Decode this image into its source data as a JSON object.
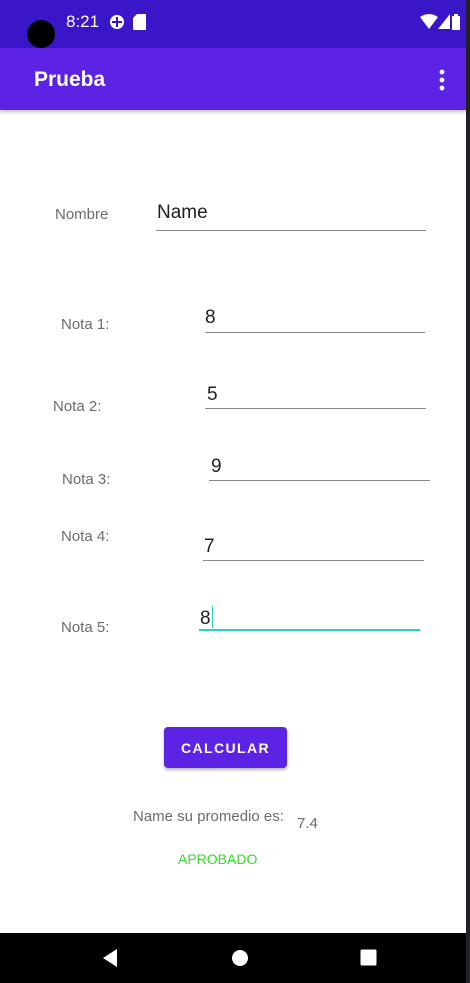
{
  "status_bar": {
    "time": "8:21"
  },
  "app_bar": {
    "title": "Prueba"
  },
  "form": {
    "nombre": {
      "label": "Nombre",
      "value": "Name"
    },
    "notas": [
      {
        "label": "Nota 1:",
        "value": "8"
      },
      {
        "label": "Nota 2:",
        "value": "5"
      },
      {
        "label": "Nota 3:",
        "value": "9"
      },
      {
        "label": "Nota 4:",
        "value": "7"
      },
      {
        "label": "Nota 5:",
        "value": "8"
      }
    ]
  },
  "calculate_button": "CALCULAR",
  "result": {
    "text": "Name su promedio es:",
    "value": "7.4",
    "status": "APROBADO",
    "status_color": "#33dd2c"
  },
  "colors": {
    "primary": "#5c23e5",
    "primary_dark": "#3b16c8",
    "accent": "#2bd3c2"
  },
  "icons": {
    "status": [
      "data-saver-icon",
      "sd-card-icon",
      "wifi-icon",
      "signal-icon",
      "battery-icon"
    ],
    "app_bar": [
      "overflow-menu-icon"
    ],
    "navigation": [
      "back-icon",
      "home-icon",
      "recents-icon"
    ]
  }
}
